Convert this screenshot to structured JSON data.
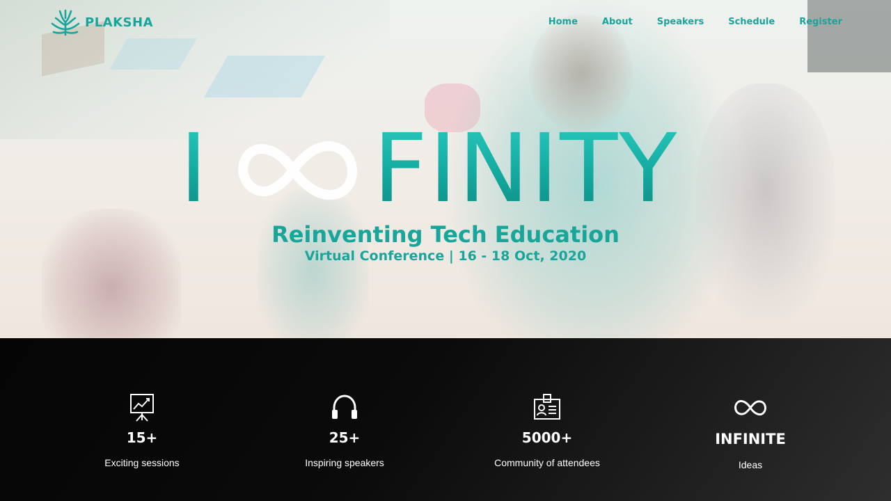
{
  "brand": {
    "name": "PLAKSHA",
    "color": "#1aa59a"
  },
  "nav": {
    "items": [
      {
        "label": "Home"
      },
      {
        "label": "About"
      },
      {
        "label": "Speakers"
      },
      {
        "label": "Schedule"
      },
      {
        "label": "Register"
      }
    ]
  },
  "hero": {
    "title_first": "I",
    "title_rest": "FINITY",
    "subtitle": "Reinventing Tech Education",
    "tagline": "Virtual Conference | 16 - 18 Oct, 2020"
  },
  "stats": [
    {
      "icon": "presentation-board-icon",
      "value": "15+",
      "label": "Exciting sessions"
    },
    {
      "icon": "headphones-icon",
      "value": "25+",
      "label": "Inspiring speakers"
    },
    {
      "icon": "id-badge-icon",
      "value": "5000+",
      "label": "Community of attendees"
    },
    {
      "icon": "infinity-icon",
      "value": "INFINITE",
      "label": "Ideas"
    }
  ],
  "colors": {
    "accent": "#1aa59a",
    "stats_background": "#0b0b0b",
    "stats_text": "#ffffff"
  }
}
